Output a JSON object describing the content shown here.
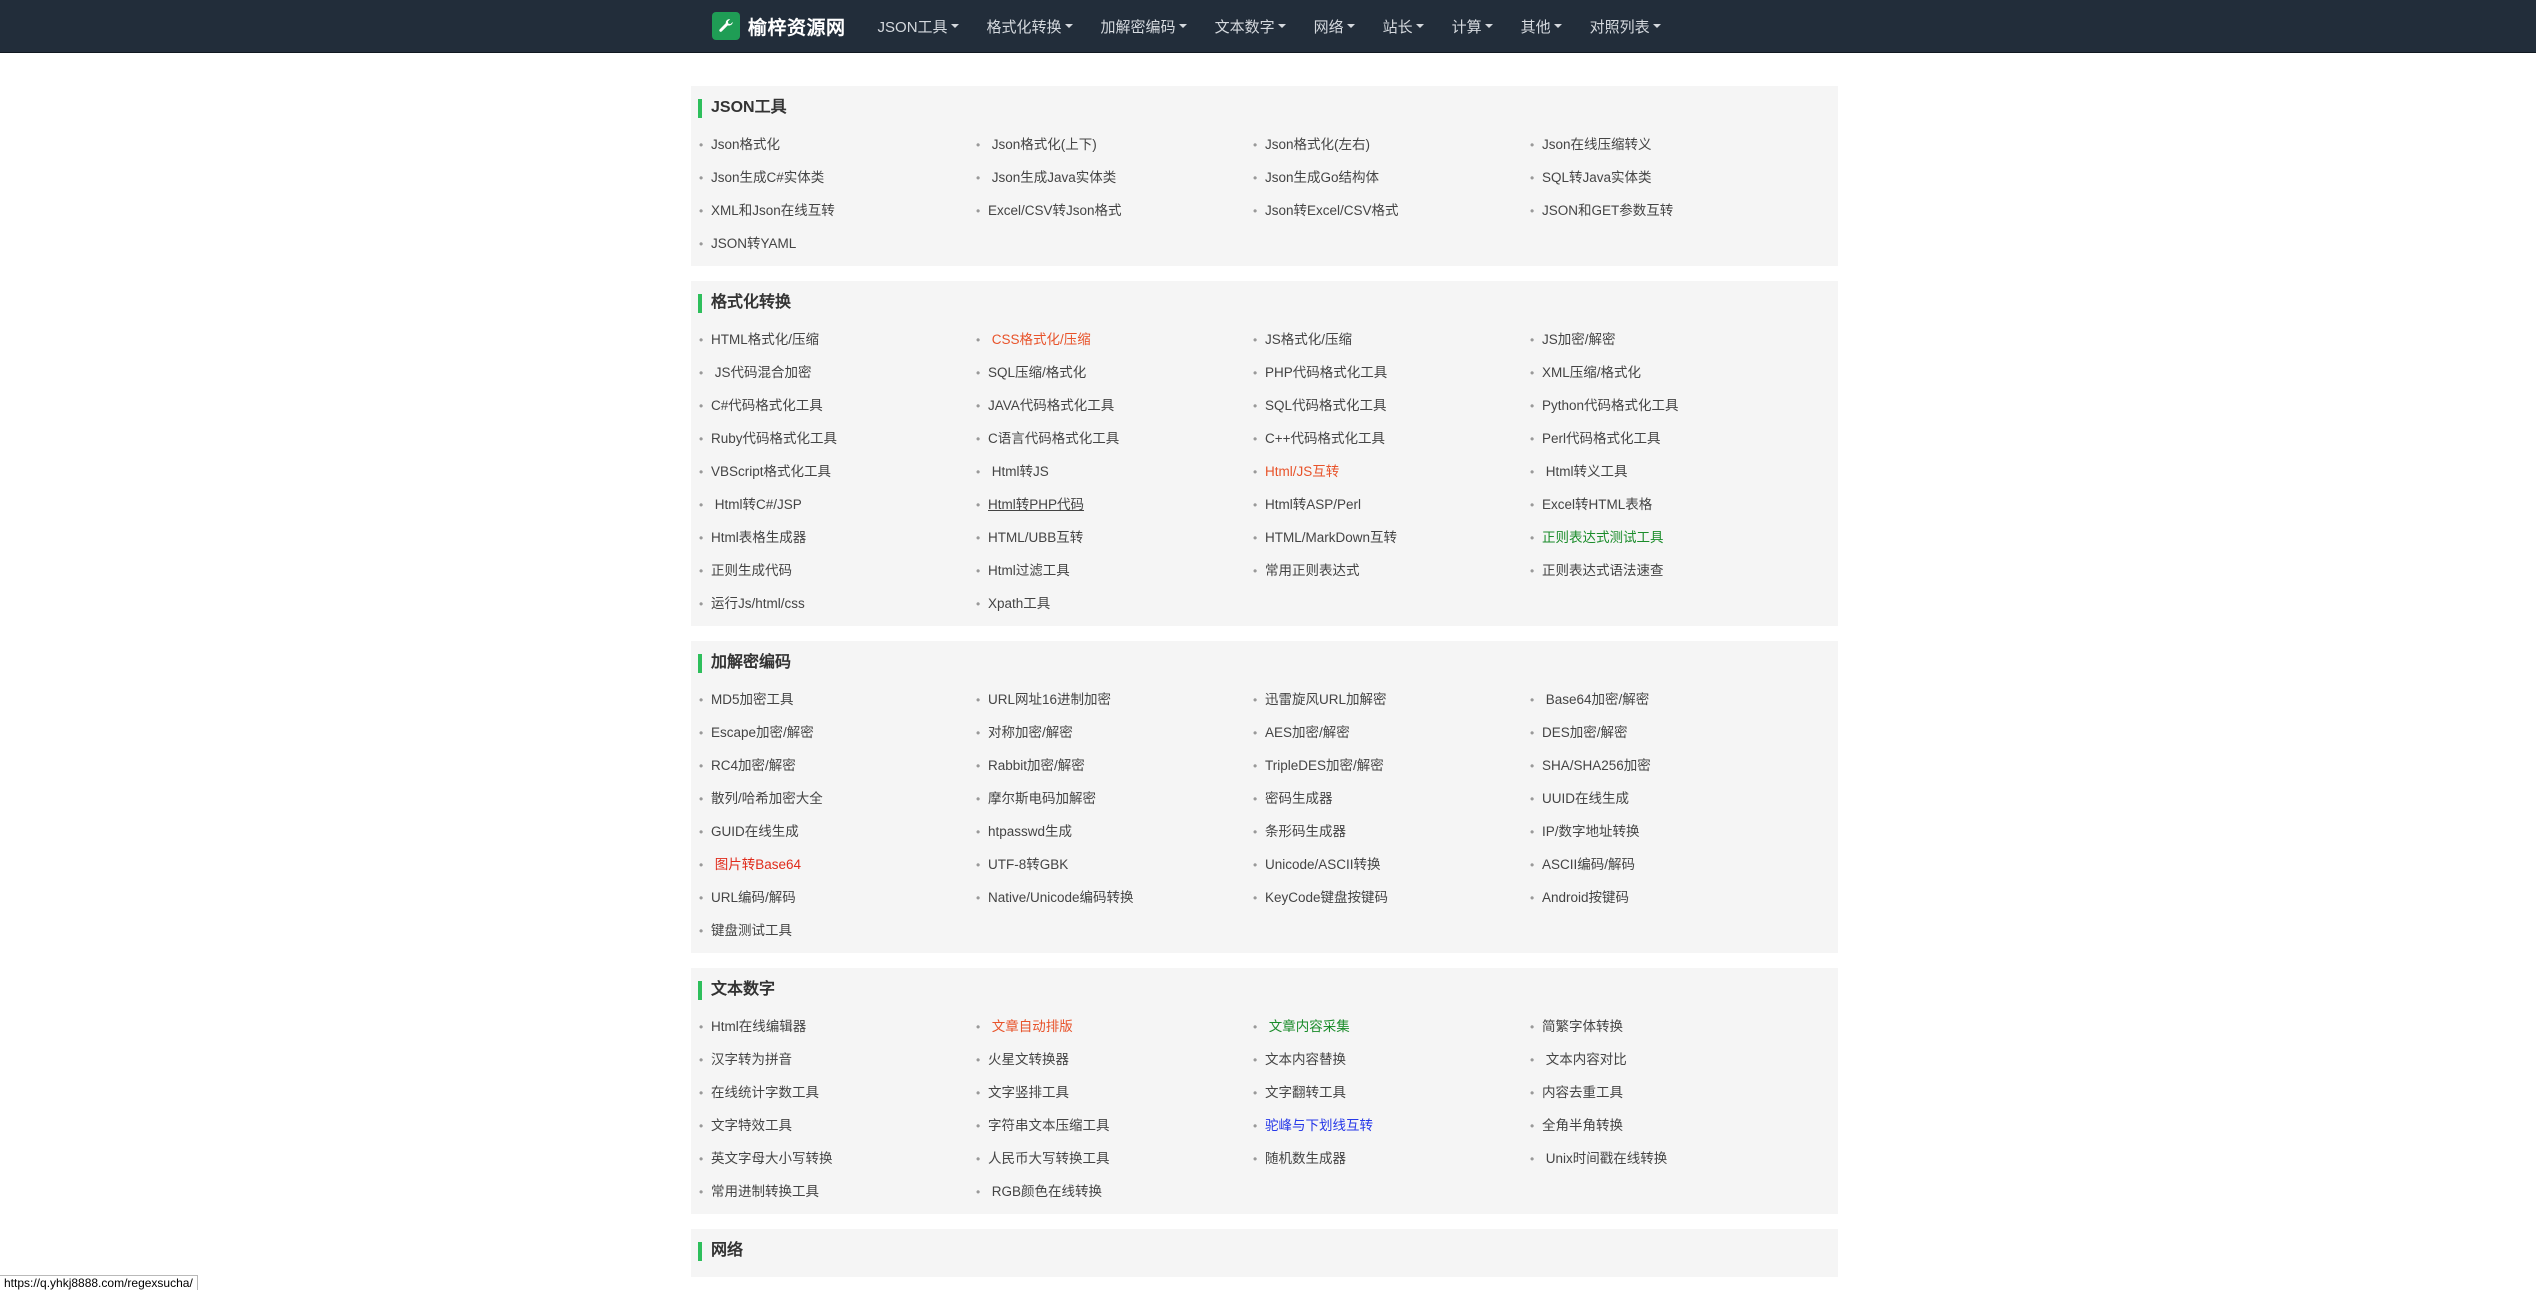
{
  "brand": {
    "name": "榆梓资源网",
    "icon": "wrench-icon",
    "color": "#1f9d55"
  },
  "nav": [
    {
      "label": "JSON工具"
    },
    {
      "label": "格式化转换"
    },
    {
      "label": "加解密编码"
    },
    {
      "label": "文本数字"
    },
    {
      "label": "网络"
    },
    {
      "label": "站长"
    },
    {
      "label": "计算"
    },
    {
      "label": "其他"
    },
    {
      "label": "对照列表"
    }
  ],
  "sections": [
    {
      "title": "JSON工具",
      "items": [
        {
          "label": "Json格式化"
        },
        {
          "label": " Json格式化(上下)"
        },
        {
          "label": "Json格式化(左右)"
        },
        {
          "label": "Json在线压缩转义"
        },
        {
          "label": "Json生成C#实体类"
        },
        {
          "label": " Json生成Java实体类"
        },
        {
          "label": "Json生成Go结构体"
        },
        {
          "label": "SQL转Java实体类"
        },
        {
          "label": "XML和Json在线互转"
        },
        {
          "label": "Excel/CSV转Json格式"
        },
        {
          "label": "Json转Excel/CSV格式"
        },
        {
          "label": "JSON和GET参数互转"
        },
        {
          "label": "JSON转YAML"
        }
      ]
    },
    {
      "title": "格式化转换",
      "items": [
        {
          "label": "HTML格式化/压缩"
        },
        {
          "label": " CSS格式化/压缩",
          "color": "orange"
        },
        {
          "label": "JS格式化/压缩"
        },
        {
          "label": "JS加密/解密"
        },
        {
          "label": " JS代码混合加密"
        },
        {
          "label": "SQL压缩/格式化"
        },
        {
          "label": "PHP代码格式化工具"
        },
        {
          "label": "XML压缩/格式化"
        },
        {
          "label": "C#代码格式化工具"
        },
        {
          "label": "JAVA代码格式化工具"
        },
        {
          "label": "SQL代码格式化工具"
        },
        {
          "label": "Python代码格式化工具"
        },
        {
          "label": "Ruby代码格式化工具"
        },
        {
          "label": "C语言代码格式化工具"
        },
        {
          "label": "C++代码格式化工具"
        },
        {
          "label": "Perl代码格式化工具"
        },
        {
          "label": "VBScript格式化工具"
        },
        {
          "label": " Html转JS"
        },
        {
          "label": "Html/JS互转",
          "color": "orange"
        },
        {
          "label": " Html转义工具"
        },
        {
          "label": " Html转C#/JSP"
        },
        {
          "label": "Html转PHP代码",
          "underline": true
        },
        {
          "label": "Html转ASP/Perl"
        },
        {
          "label": "Excel转HTML表格"
        },
        {
          "label": "Html表格生成器"
        },
        {
          "label": "HTML/UBB互转"
        },
        {
          "label": "HTML/MarkDown互转"
        },
        {
          "label": "正则表达式测试工具",
          "color": "green"
        },
        {
          "label": "正则生成代码"
        },
        {
          "label": "Html过滤工具"
        },
        {
          "label": "常用正则表达式"
        },
        {
          "label": "正则表达式语法速查"
        },
        {
          "label": "运行Js/html/css"
        },
        {
          "label": "Xpath工具"
        }
      ]
    },
    {
      "title": "加解密编码",
      "items": [
        {
          "label": "MD5加密工具"
        },
        {
          "label": "URL网址16进制加密"
        },
        {
          "label": "迅雷旋风URL加解密"
        },
        {
          "label": " Base64加密/解密"
        },
        {
          "label": "Escape加密/解密"
        },
        {
          "label": "对称加密/解密"
        },
        {
          "label": "AES加密/解密"
        },
        {
          "label": "DES加密/解密"
        },
        {
          "label": "RC4加密/解密"
        },
        {
          "label": "Rabbit加密/解密"
        },
        {
          "label": "TripleDES加密/解密"
        },
        {
          "label": "SHA/SHA256加密"
        },
        {
          "label": "散列/哈希加密大全"
        },
        {
          "label": "摩尔斯电码加解密"
        },
        {
          "label": "密码生成器"
        },
        {
          "label": "UUID在线生成"
        },
        {
          "label": "GUID在线生成"
        },
        {
          "label": "htpasswd生成"
        },
        {
          "label": "条形码生成器"
        },
        {
          "label": "IP/数字地址转换"
        },
        {
          "label": " 图片转Base64",
          "color": "red"
        },
        {
          "label": "UTF-8转GBK"
        },
        {
          "label": "Unicode/ASCII转换"
        },
        {
          "label": "ASCII编码/解码"
        },
        {
          "label": "URL编码/解码"
        },
        {
          "label": "Native/Unicode编码转换"
        },
        {
          "label": "KeyCode键盘按键码"
        },
        {
          "label": "Android按键码"
        },
        {
          "label": "键盘测试工具"
        }
      ]
    },
    {
      "title": "文本数字",
      "items": [
        {
          "label": "Html在线编辑器"
        },
        {
          "label": " 文章自动排版",
          "color": "orange"
        },
        {
          "label": " 文章内容采集",
          "color": "green"
        },
        {
          "label": "简繁字体转换"
        },
        {
          "label": "汉字转为拼音"
        },
        {
          "label": "火星文转换器"
        },
        {
          "label": "文本内容替换"
        },
        {
          "label": " 文本内容对比"
        },
        {
          "label": "在线统计字数工具"
        },
        {
          "label": "文字竖排工具"
        },
        {
          "label": "文字翻转工具"
        },
        {
          "label": "内容去重工具"
        },
        {
          "label": "文字特效工具"
        },
        {
          "label": "字符串文本压缩工具"
        },
        {
          "label": "驼峰与下划线互转",
          "color": "blue"
        },
        {
          "label": "全角半角转换"
        },
        {
          "label": "英文字母大小写转换"
        },
        {
          "label": "人民币大写转换工具"
        },
        {
          "label": "随机数生成器"
        },
        {
          "label": " Unix时间戳在线转换"
        },
        {
          "label": "常用进制转换工具"
        },
        {
          "label": " RGB颜色在线转换"
        }
      ]
    },
    {
      "title": "网络",
      "items": []
    }
  ],
  "status_url": "https://q.yhkj8888.com/regexsucha/"
}
